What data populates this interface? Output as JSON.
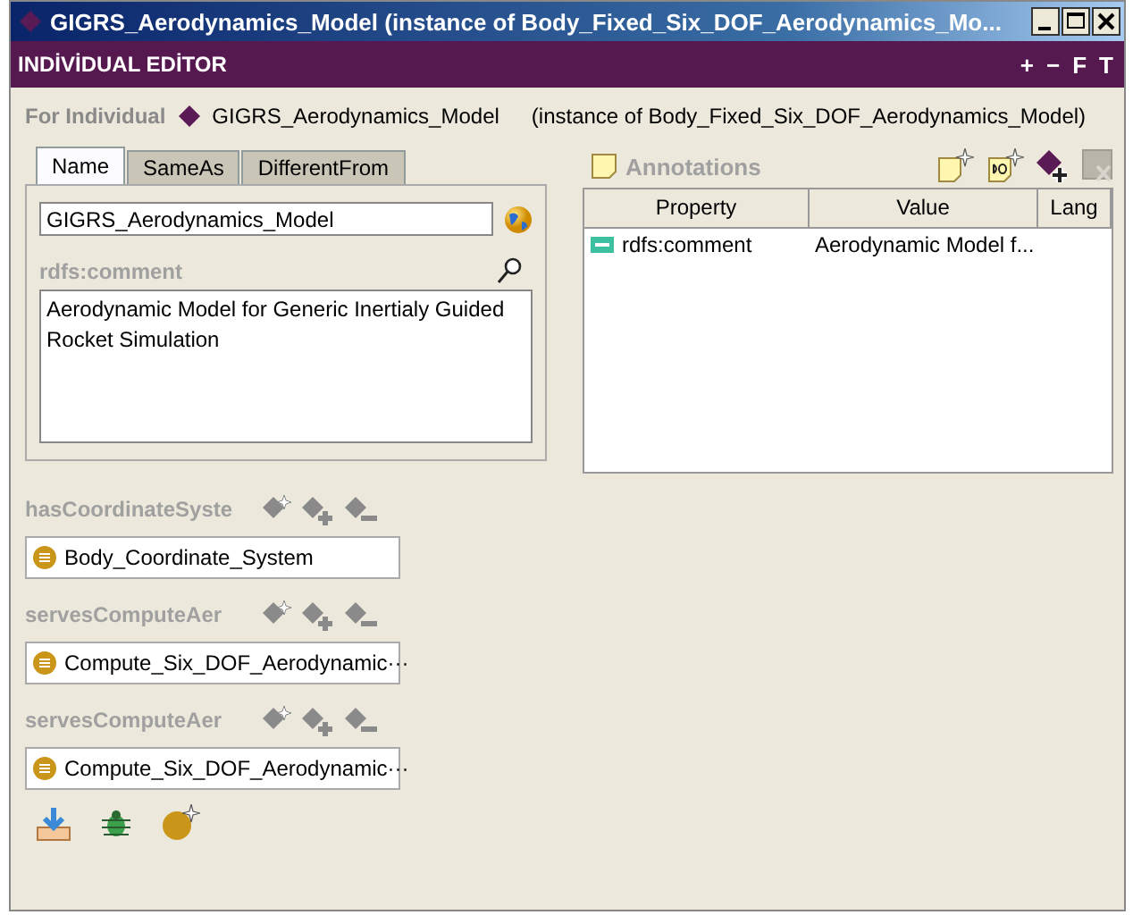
{
  "window": {
    "title": "GIGRS_Aerodynamics_Model   (instance of Body_Fixed_Six_DOF_Aerodynamics_Mo..."
  },
  "editor_header": {
    "title": "INDİVİDUAL EDİTOR",
    "buttons": [
      "+",
      "−",
      "F",
      "T"
    ]
  },
  "for_individual": {
    "label": "For Individual",
    "name": "GIGRS_Aerodynamics_Model",
    "instance": "(instance of Body_Fixed_Six_DOF_Aerodynamics_Model)"
  },
  "tabs": [
    {
      "label": "Name",
      "selected": true
    },
    {
      "label": "SameAs",
      "selected": false
    },
    {
      "label": "DifferentFrom",
      "selected": false
    }
  ],
  "name_field": {
    "value": "GIGRS_Aerodynamics_Model"
  },
  "comment": {
    "label": "rdfs:comment",
    "value": "Aerodynamic Model for Generic Inertialy Guided Rocket Simulation "
  },
  "annotations": {
    "title": "Annotations",
    "columns": [
      "Property",
      "Value",
      "Lang"
    ],
    "rows": [
      {
        "property": "rdfs:comment",
        "value": "Aerodynamic Model f..."
      }
    ]
  },
  "slots": [
    {
      "label": "hasCoordinateSyste",
      "value": "Body_Coordinate_System"
    },
    {
      "label": "servesComputeAer",
      "value": "Compute_Six_DOF_Aerodynamic···"
    },
    {
      "label": "servesComputeAer",
      "value": "Compute_Six_DOF_Aerodynamic···"
    }
  ]
}
